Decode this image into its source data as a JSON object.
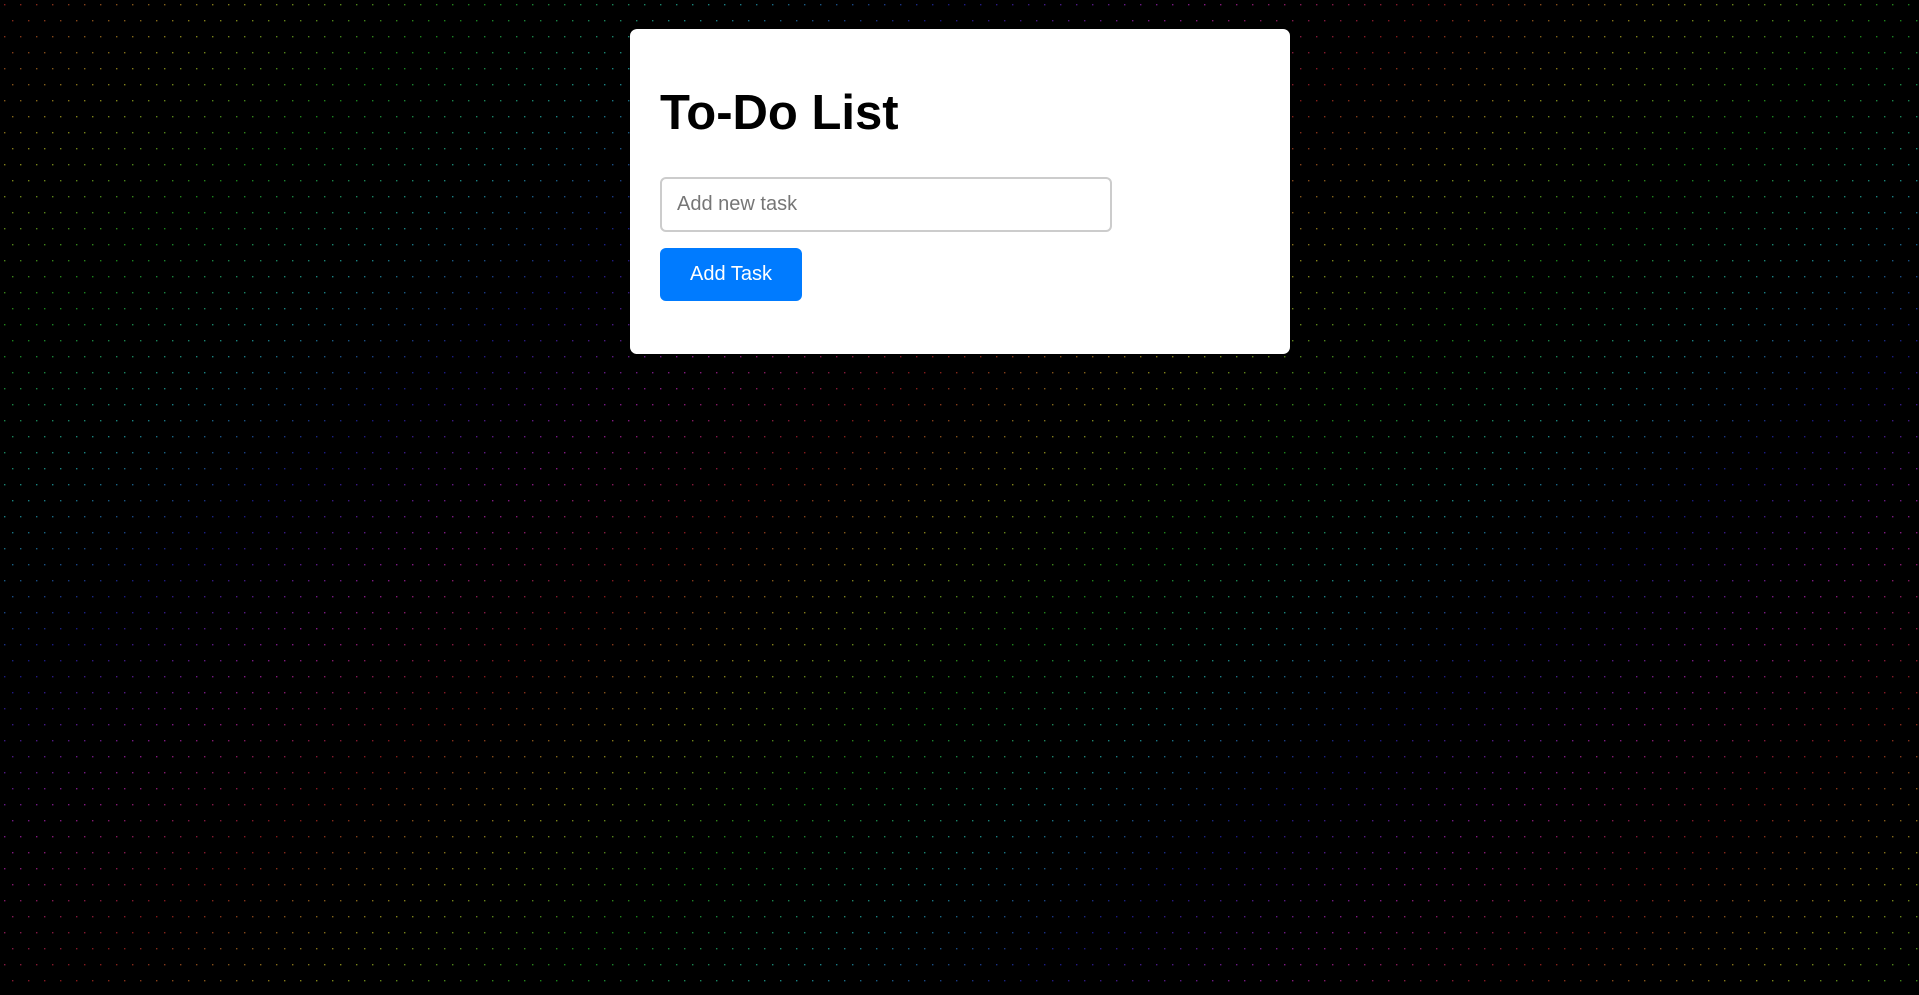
{
  "app": {
    "title": "To-Do List",
    "background_color": "#000000"
  },
  "task_input": {
    "placeholder": "Add new task",
    "value": ""
  },
  "add_button": {
    "label": "Add Task",
    "color": "#007bff"
  },
  "tasks": []
}
